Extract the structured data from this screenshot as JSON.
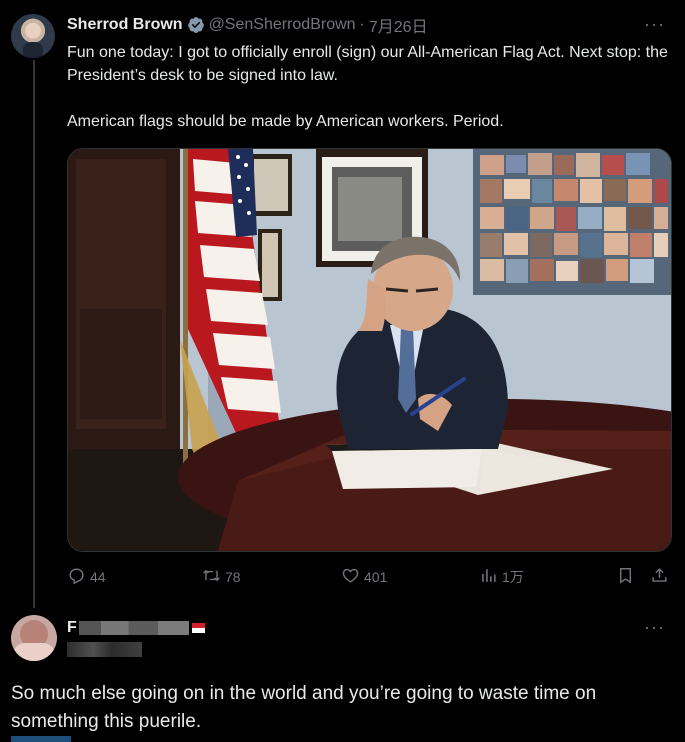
{
  "tweet": {
    "author_name": "Sherrod Brown",
    "handle": "@SenSherrodBrown",
    "dot": "·",
    "date": "7月26日",
    "more": "···",
    "text_line1": "Fun one today: I got to officially enroll (sign) our All-American Flag Act. Next stop: the President’s desk to be signed into law.",
    "text_line2": "American flags should be made by American workers. Period.",
    "verified_icon": "verified-badge-icon",
    "actions": {
      "reply_count": "44",
      "retweet_count": "78",
      "like_count": "401",
      "views_count": "1万"
    },
    "colors": {
      "verified_badge": "#829aab",
      "text_secondary": "#71767b"
    }
  },
  "reply": {
    "name_initial": "F",
    "more": "···",
    "text": "So much else going on in the world and you’re going to waste time on something this puerile."
  }
}
